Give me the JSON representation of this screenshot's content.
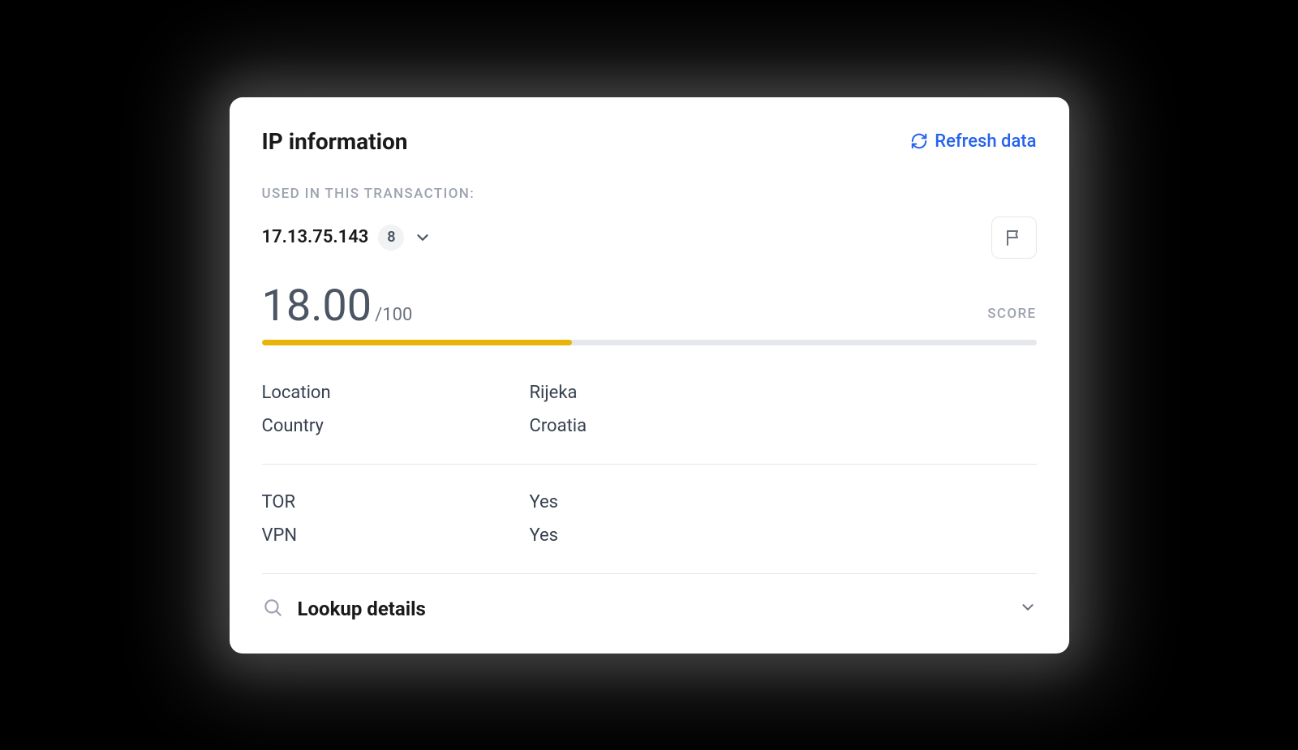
{
  "header": {
    "title": "IP information",
    "refresh_label": "Refresh data"
  },
  "transaction": {
    "section_label": "USED IN THIS TRANSACTION:",
    "ip_address": "17.13.75.143",
    "count_badge": "8"
  },
  "score": {
    "value": "18.00",
    "max_suffix": "/100",
    "label": "SCORE",
    "fill_percent": 40,
    "fill_color": "#eab308"
  },
  "details": {
    "group1": [
      {
        "label": "Location",
        "value": "Rijeka"
      },
      {
        "label": "Country",
        "value": "Croatia"
      }
    ],
    "group2": [
      {
        "label": "TOR",
        "value": "Yes"
      },
      {
        "label": "VPN",
        "value": "Yes"
      }
    ]
  },
  "lookup": {
    "title": "Lookup details"
  }
}
